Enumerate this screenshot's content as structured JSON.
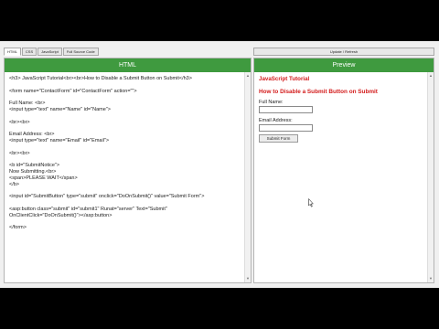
{
  "tabs": [
    {
      "label": "HTML",
      "active": true
    },
    {
      "label": "CSS",
      "active": false
    },
    {
      "label": "JavaScript",
      "active": false
    },
    {
      "label": "Full Source Code",
      "active": false
    }
  ],
  "run_button": "Update / Refresh",
  "html_pane": {
    "title": "HTML",
    "code_lines": [
      "<h3> JavaScript Tutorial<br><br>How to Disable a Submit Button on Submit</h3>",
      "",
      "<form name=\"ContactForm\" id=\"ContactForm\" action=\"\">",
      "",
      "Full Name: <br>",
      "<input type=\"text\" name=\"Name\" id=\"Name\">",
      "",
      "<br><br>",
      "",
      "Email Address: <br>",
      "<input type=\"text\" name=\"Email\" id=\"Email\">",
      "",
      "<br><br>",
      "",
      "<b id=\"SubmitNotice\">",
      "Now Submitting.<br>",
      "<span>PLEASE WAIT</span>",
      "</b>",
      "",
      "<input id=\"SubmitButton\" type=\"submit\" onclick=\"DoOnSubmit()\" value=\"Submit Form\">",
      "",
      "<asp:button class=\"submit\" id=\"submit1\" Runat=\"server\" Text=\"Submit\"",
      "OnClientClick=\"DoOnSubmit()\"></asp:button>",
      "",
      "</form>"
    ]
  },
  "preview_pane": {
    "title": "Preview",
    "heading": "JavaScript Tutorial",
    "subheading": "How to Disable a Submit Button on Submit",
    "name_label": "Full Name:",
    "email_label": "Email Address:",
    "submit_label": "Submit Form"
  },
  "colors": {
    "header_green": "#3f9a3f",
    "heading_red": "#d31b1b"
  },
  "icons": [
    "scroll-up-icon",
    "scroll-down-icon",
    "mouse-pointer-icon"
  ]
}
